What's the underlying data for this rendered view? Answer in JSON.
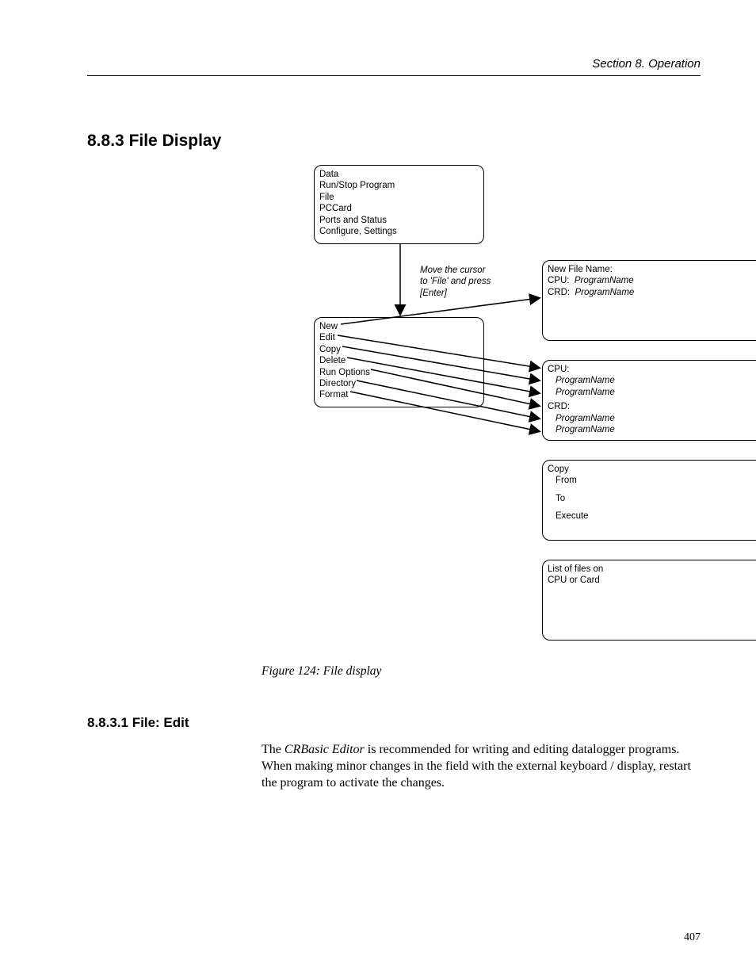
{
  "header": {
    "running": "Section 8.  Operation"
  },
  "section": {
    "num": "8.8.3",
    "title": "File Display"
  },
  "diagram": {
    "menu": {
      "items": [
        "Data",
        "Run/Stop Program",
        "File",
        "PCCard",
        "Ports and Status",
        "Configure, Settings"
      ]
    },
    "instruction": {
      "l1": "Move the cursor",
      "l2": "to 'File' and press",
      "l3": "[Enter]"
    },
    "file_menu": {
      "items": [
        "New",
        "Edit",
        "Copy",
        "Delete",
        "Run Options",
        "Directory",
        "Format"
      ]
    },
    "new_box": {
      "title": "New File Name:",
      "l1_label": "CPU:",
      "l1_val": "ProgramName",
      "l2_label": "CRD:",
      "l2_val": "ProgramName"
    },
    "dir_box": {
      "cpu": "CPU:",
      "cpu1": "ProgramName",
      "cpu2": "ProgramName",
      "crd": "CRD:",
      "crd1": "ProgramName",
      "crd2": "ProgramName"
    },
    "copy_box": {
      "title": "Copy",
      "from": "From",
      "to": "To",
      "exec": "Execute"
    },
    "list_box": {
      "l1": "List of files on",
      "l2": "CPU or Card"
    }
  },
  "caption": "Figure 124: File display",
  "subsection": {
    "num": "8.8.3.1",
    "title": "File: Edit"
  },
  "paragraph": {
    "pre": "The ",
    "emph": "CRBasic Editor",
    "post": " is recommended for writing and editing datalogger programs. When making minor changes in the field with the external keyboard / display, restart the program to activate the changes."
  },
  "page_number": "407"
}
